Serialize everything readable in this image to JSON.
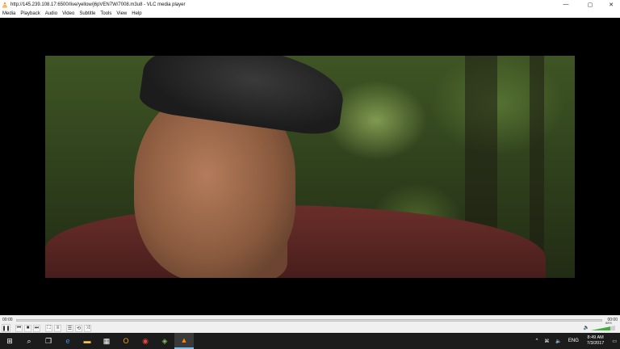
{
  "window": {
    "title": "http://145.239.108.17:6500/live/yellow/j6pVEN7W/7008.m3u8 - VLC media player",
    "controls": {
      "minimize": "—",
      "maximize": "▢",
      "close": "✕"
    }
  },
  "menu": [
    "Media",
    "Playback",
    "Audio",
    "Video",
    "Subtitle",
    "Tools",
    "View",
    "Help"
  ],
  "player": {
    "elapsed": "00:00",
    "remaining": "00:00",
    "volume": "88%",
    "volume_level": 0.8,
    "buttons": {
      "pause": "❚❚",
      "prev": "⏮",
      "stop": "■",
      "next": "⏭",
      "fullscreen": "⛶",
      "extended": "≡",
      "playlist": "☰",
      "loop": "⟲",
      "random": "⤨"
    }
  },
  "taskbar": {
    "start": "⊞",
    "search": "⌕",
    "taskview": "❐",
    "apps": [
      {
        "name": "edge-icon",
        "glyph": "e",
        "color": "#3b8ee8"
      },
      {
        "name": "file-explorer-icon",
        "glyph": "▬",
        "color": "#f2c14e"
      },
      {
        "name": "store-icon",
        "glyph": "▦",
        "color": "#ffffff"
      },
      {
        "name": "outlook-icon",
        "glyph": "O",
        "color": "#f0a30a"
      },
      {
        "name": "chrome-icon",
        "glyph": "◉",
        "color": "#e8453c"
      },
      {
        "name": "app-icon",
        "glyph": "◈",
        "color": "#7fbf5f"
      },
      {
        "name": "vlc-icon",
        "glyph": "▲",
        "color": "#ff8800"
      }
    ],
    "tray": {
      "chevron": "^",
      "network": "⌘",
      "volume": "🔈",
      "language": "ENG",
      "time": "8:49 AM",
      "date": "7/3/2017",
      "notifications": "▭"
    }
  }
}
